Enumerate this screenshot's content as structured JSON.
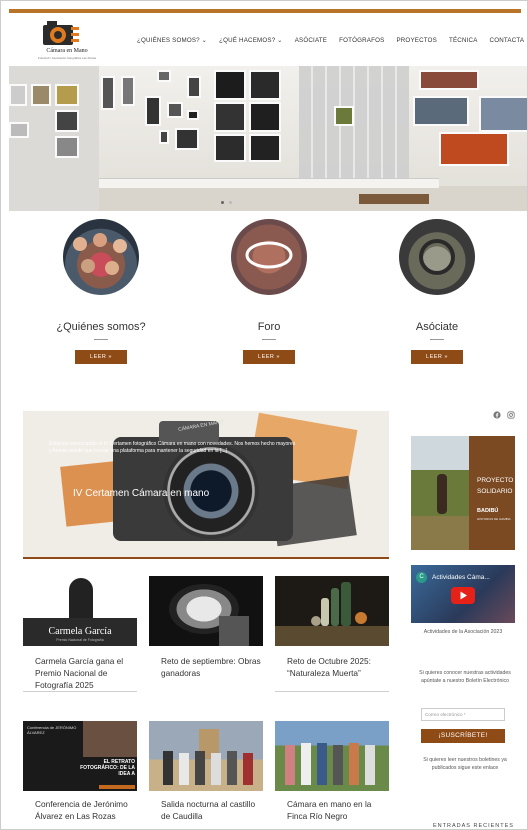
{
  "site": {
    "logo_text": "Cámara en Mano",
    "logo_sub": "Fotoclub / Asociación fotográfica Las Rozas"
  },
  "nav": {
    "items": [
      {
        "label": "¿QUIÉNES SOMOS? ⌄"
      },
      {
        "label": "¿QUÉ HACEMOS? ⌄"
      },
      {
        "label": "ASÓCIATE"
      },
      {
        "label": "FOTÓGRAFOS"
      },
      {
        "label": "PROYECTOS"
      },
      {
        "label": "TÉCNICA"
      },
      {
        "label": "CONTACTA"
      }
    ],
    "search_icon": "search-icon"
  },
  "hero": {
    "slides": 2,
    "active_slide": 1
  },
  "features": [
    {
      "title": "¿Quiénes somos?",
      "button": "LEER »"
    },
    {
      "title": "Foro",
      "button": "LEER »"
    },
    {
      "title": "Asóciate",
      "button": "LEER »"
    }
  ],
  "featured_post": {
    "caption": "Estamos convocando el IV Certamen fotográfico Cámara en mano con novedades. Nos hemos hecho mayores y hemos tenido que buscar una plataforma para mantener la seguridad en la [...]",
    "title": "IV Certamen Cámara en mano",
    "image_text": "CÁMARA EN MANO"
  },
  "posts": [
    {
      "title": "Carmela García gana el Premio Nacional de Fotografía 2025",
      "image_text": "Carmela García",
      "image_sub": "Premio Nacional de Fotografía"
    },
    {
      "title": "Reto de septiembre: Obras ganadoras",
      "image_text": ""
    },
    {
      "title": "Reto de Octubre 2025: “Naturaleza Muerta”",
      "image_text": ""
    },
    {
      "title": "Conferencia de Jerónimo Álvarez en Las Rozas",
      "image_text": "EL RETRATO FOTOGRÁFICO: DE LA IDEA A",
      "image_sub": "Conferencia de JERÓNIMO ÁLVAREZ"
    },
    {
      "title": "Salida nocturna al castillo de Caudilla",
      "image_text": ""
    },
    {
      "title": "Cámara en mano en la Finca Río Negro",
      "image_text": ""
    }
  ],
  "social": {
    "icons": [
      "facebook-icon",
      "instagram-icon"
    ]
  },
  "sidebar": {
    "banner_line1": "PROYECTO",
    "banner_line2": "SOLIDARIO",
    "banner_line3": "BADIBÚ",
    "banner_line4": "HISTORIAS DE GAMBIA",
    "video_title": "Actividades Cáma...",
    "video_letter": "C",
    "video_caption": "Actividades de la Asociación 2023",
    "newsletter_text": "Si quieres conocer nuestras actividades apúntate a nuestro Boletín Electrónico",
    "email_placeholder": "Correo electrónico *",
    "subscribe_label": "¡SUSCRÍBETE!",
    "archive_text": "Si quieres leer nuestros boletines ya publicados sigue este enlace",
    "recent_heading": "ENTRADAS RECIENTES"
  },
  "colors": {
    "accent": "#8f4b16",
    "topline": "#b8752a"
  }
}
